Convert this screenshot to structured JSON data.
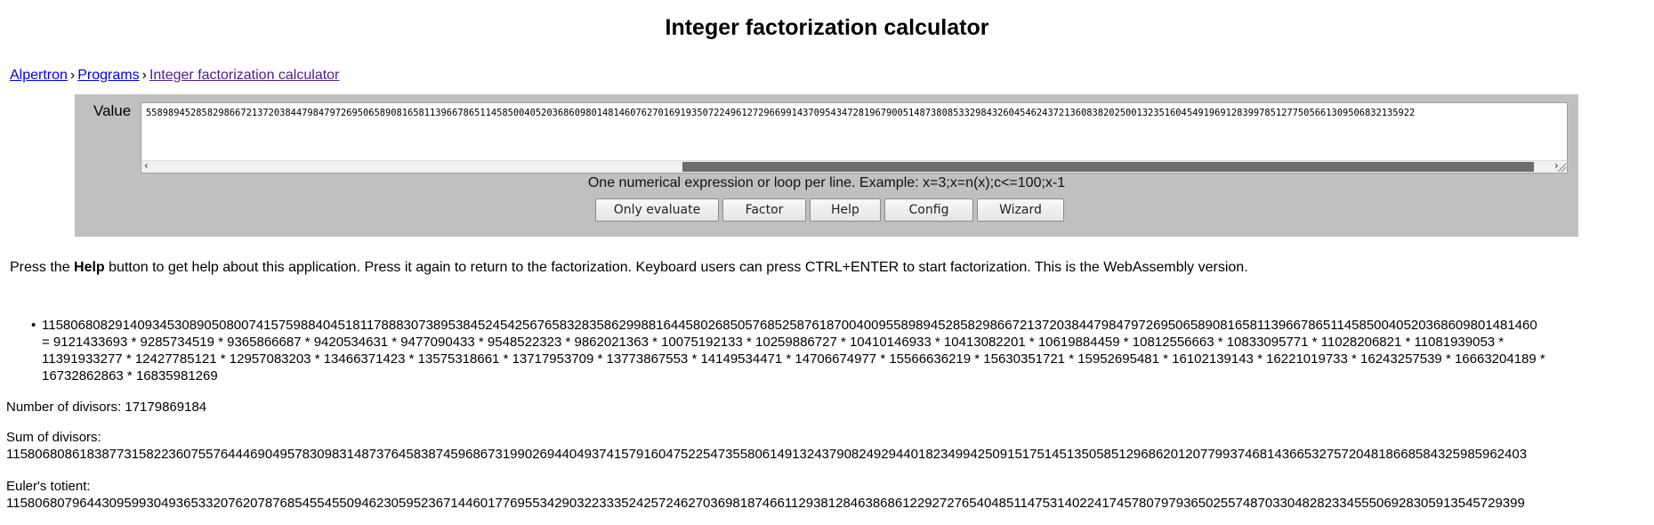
{
  "page": {
    "title": "Integer factorization calculator"
  },
  "breadcrumb": {
    "home": "Alpertron",
    "sep1": "›",
    "programs": "Programs",
    "sep2": "›",
    "current": "Integer factorization calculator"
  },
  "form": {
    "value_label": "Value",
    "value_text": "558989452858298667213720384479847972695065890816581139667865114585004052036860980148146076270169193507224961272966991437095434728196790051487380853329843260454624372136083820250013235160454919691283997851277505661309506832135922",
    "hint": "One numerical expression or loop per line. Example: x=3;x=n(x);c<=100;x-1",
    "buttons": {
      "only_evaluate": "Only evaluate",
      "factor": "Factor",
      "help": "Help",
      "config": "Config",
      "wizard": "Wizard"
    }
  },
  "help_text": {
    "before": "Press the ",
    "bold": "Help",
    "after": " button to get help about this application. Press it again to return to the factorization. Keyboard users can press CTRL+ENTER to start factorization. This is the WebAssembly version."
  },
  "result": {
    "bullet": "•",
    "number": "1158068082914093453089050800741575988404518117888307389538452454256765832835862998816445802685057685258761870040095589894528582986672137203844798479726950658908165811396678651145850040520368609801481460",
    "line2": "= 9121433693 * 9285734519 * 9365866687 * 9420534631 * 9477090433 * 9548522323 * 9862021363 * 10075192133 * 10259886727 * 10410146933 * 10413082201 * 10619884459 * 10812556663 * 10833095771 * 11028206821 * 11081939053 *",
    "line3": "11391933277 * 12427785121 * 12957083203 * 13466371423 * 13575318661 * 13717953709 * 13773867553 * 14149534471 * 14706674977 * 15566636219 * 15630351721 * 15952695481 * 16102139143 * 16221019733 * 16243257539 * 16663204189 *",
    "line4": "16732862863 * 16835981269"
  },
  "info": {
    "divisors_label": "Number of divisors: ",
    "divisors_value": "17179869184",
    "sum_label": "Sum of divisors:",
    "sum_value": "1158068086183877315822360755764446904957830983148737645838745968673199026944049374157916047522547355806149132437908249294401823499425091517514513505851296862012077993746814366532757204818668584325985962403",
    "totient_label": "Euler's totient:",
    "totient_value": "1158068079644309599304936533207620787685455455094623059523671446017769553429032233352425724627036981874661129381284638686122927276540485114753140224174578079793650255748703304828233455506928305913545729399"
  },
  "colors": {
    "panel_bg": "#c0c0c0",
    "link": "#0000ee",
    "visited_link": "#551a8b"
  }
}
